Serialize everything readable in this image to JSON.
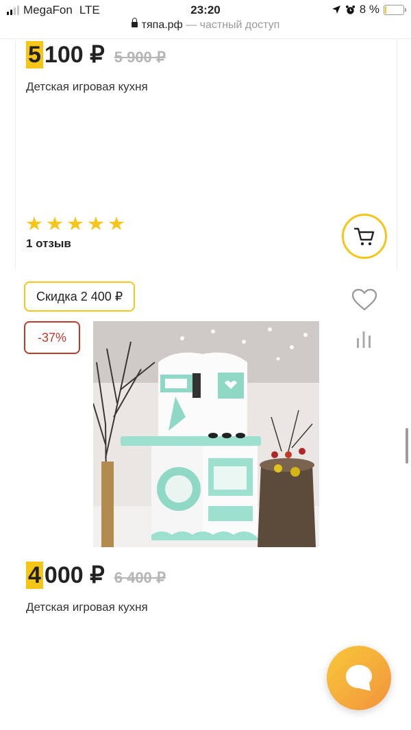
{
  "status_bar": {
    "carrier": "MegaFon",
    "network": "LTE",
    "time": "23:20",
    "battery": "8 %",
    "battery_level": 0.08
  },
  "url_bar": {
    "domain": "тяпа.рф",
    "suffix": "— частный доступ"
  },
  "products": [
    {
      "price_first_digit": "5",
      "price_rest": "100 ₽",
      "old_price": "5 900 ₽",
      "title": "Детская игровая кухня",
      "rating": 5,
      "reviews": "1 отзыв"
    },
    {
      "discount_badge": "Скидка 2 400 ₽",
      "discount_percent": "-37%",
      "price_first_digit": "4",
      "price_rest": "000 ₽",
      "old_price": "6 400 ₽",
      "title": "Детская игровая кухня"
    }
  ],
  "colors": {
    "accent": "#f5c518",
    "discount_red": "#c0392b"
  }
}
